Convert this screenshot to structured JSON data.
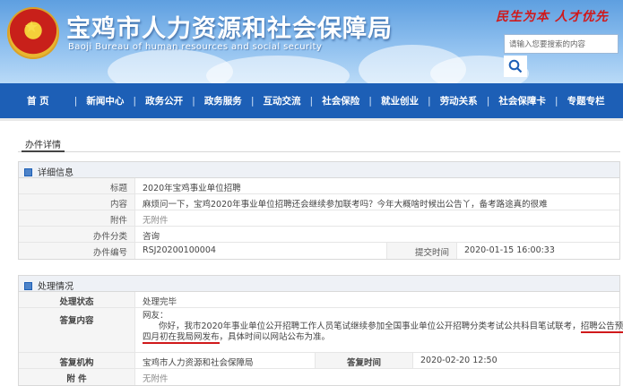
{
  "header": {
    "title": "宝鸡市人力资源和社会保障局",
    "subtitle": "Baoji Bureau of human resources and social security",
    "slogan": "民生为本 人才优先",
    "search_placeholder": "请输入您要搜索的内容"
  },
  "nav": {
    "items": [
      "首 页",
      "新闻中心",
      "政务公开",
      "政务服务",
      "互动交流",
      "社会保险",
      "就业创业",
      "劳动关系",
      "社会保障卡",
      "专题专栏"
    ]
  },
  "tabs": [
    "办件详情"
  ],
  "detail": {
    "section_title": "详细信息",
    "title_label": "标题",
    "title_value": "2020年宝鸡事业单位招聘",
    "content_label": "内容",
    "content_value": "麻烦问一下，宝鸡2020年事业单位招聘还会继续参加联考吗？今年大概啥时候出公告丫，备考路途真的很难",
    "attachment_label": "附件",
    "attachment_value": "无附件",
    "category_label": "办件分类",
    "category_value": "咨询",
    "number_label": "办件编号",
    "number_value": "RSJ20200100004",
    "submit_time_label": "提交时间",
    "submit_time_value": "2020-01-15 16:00:33"
  },
  "handling": {
    "section_title": "处理情况",
    "status_label": "处理状态",
    "status_value": "处理完毕",
    "reply_label": "答复内容",
    "reply_greeting": "网友：",
    "reply_line1_pre": "你好，我市2020年事业单位公开招聘工作人员笔试继续参加全国事业单位公开招聘分类考试公共科目笔试联考，",
    "reply_line1_mark": "招聘公告预计",
    "reply_line2_mark": "四月初在我局网发布",
    "reply_line2_post": "，具体时间以网站公布为准。",
    "org_label": "答复机构",
    "org_value": "宝鸡市人力资源和社会保障局",
    "reply_time_label": "答复时间",
    "reply_time_value": "2020-02-20 12:50",
    "attachment_label": "附 件",
    "attachment_value": "无附件"
  },
  "colors": {
    "nav_blue": "#1d5fb6",
    "highlight_red": "#d0191b"
  }
}
